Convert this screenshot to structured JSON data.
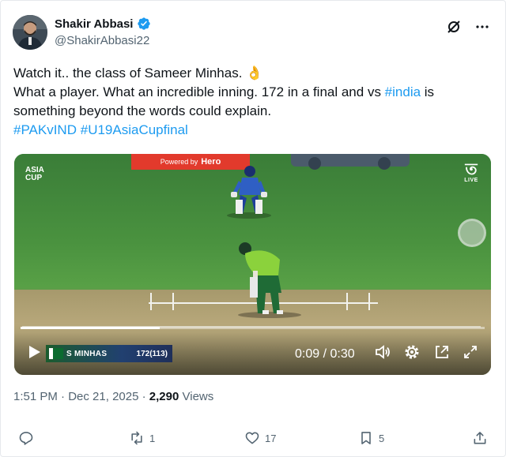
{
  "author": {
    "name": "Shakir Abbasi",
    "handle": "@ShakirAbbasi22"
  },
  "tweet": {
    "line1_text": "Watch it.. the class of Sameer Minhas. ",
    "line1_emoji": "👌",
    "line2_before": "What a player. What an incredible inning. 172 in a final and vs ",
    "line2_link": "#india",
    "line2_after": " is something beyond the words could explain.",
    "hashtag1": "#PAKvIND",
    "hashtag2": "#U19AsiaCupfinal"
  },
  "video": {
    "sponsor_prefix": "Powered by",
    "sponsor_brand": "Hero",
    "tournament_logo_line1": "ASIA",
    "tournament_logo_line2": "CUP",
    "channel_live": "LIVE",
    "scorebug_name": "S MINHAS",
    "scorebug_score": "172(113)",
    "time_display": "0:09 / 0:30",
    "progress_fraction": 0.3
  },
  "meta": {
    "time": "1:51 PM",
    "date": "Dec 21, 2025",
    "views_count": "2,290",
    "views_label": "Views"
  },
  "actions": {
    "reposts": "1",
    "likes": "17",
    "bookmarks": "5"
  },
  "colors": {
    "link": "#1d9bf0",
    "verified": "#1d9bf0",
    "secondary_text": "#536471"
  }
}
